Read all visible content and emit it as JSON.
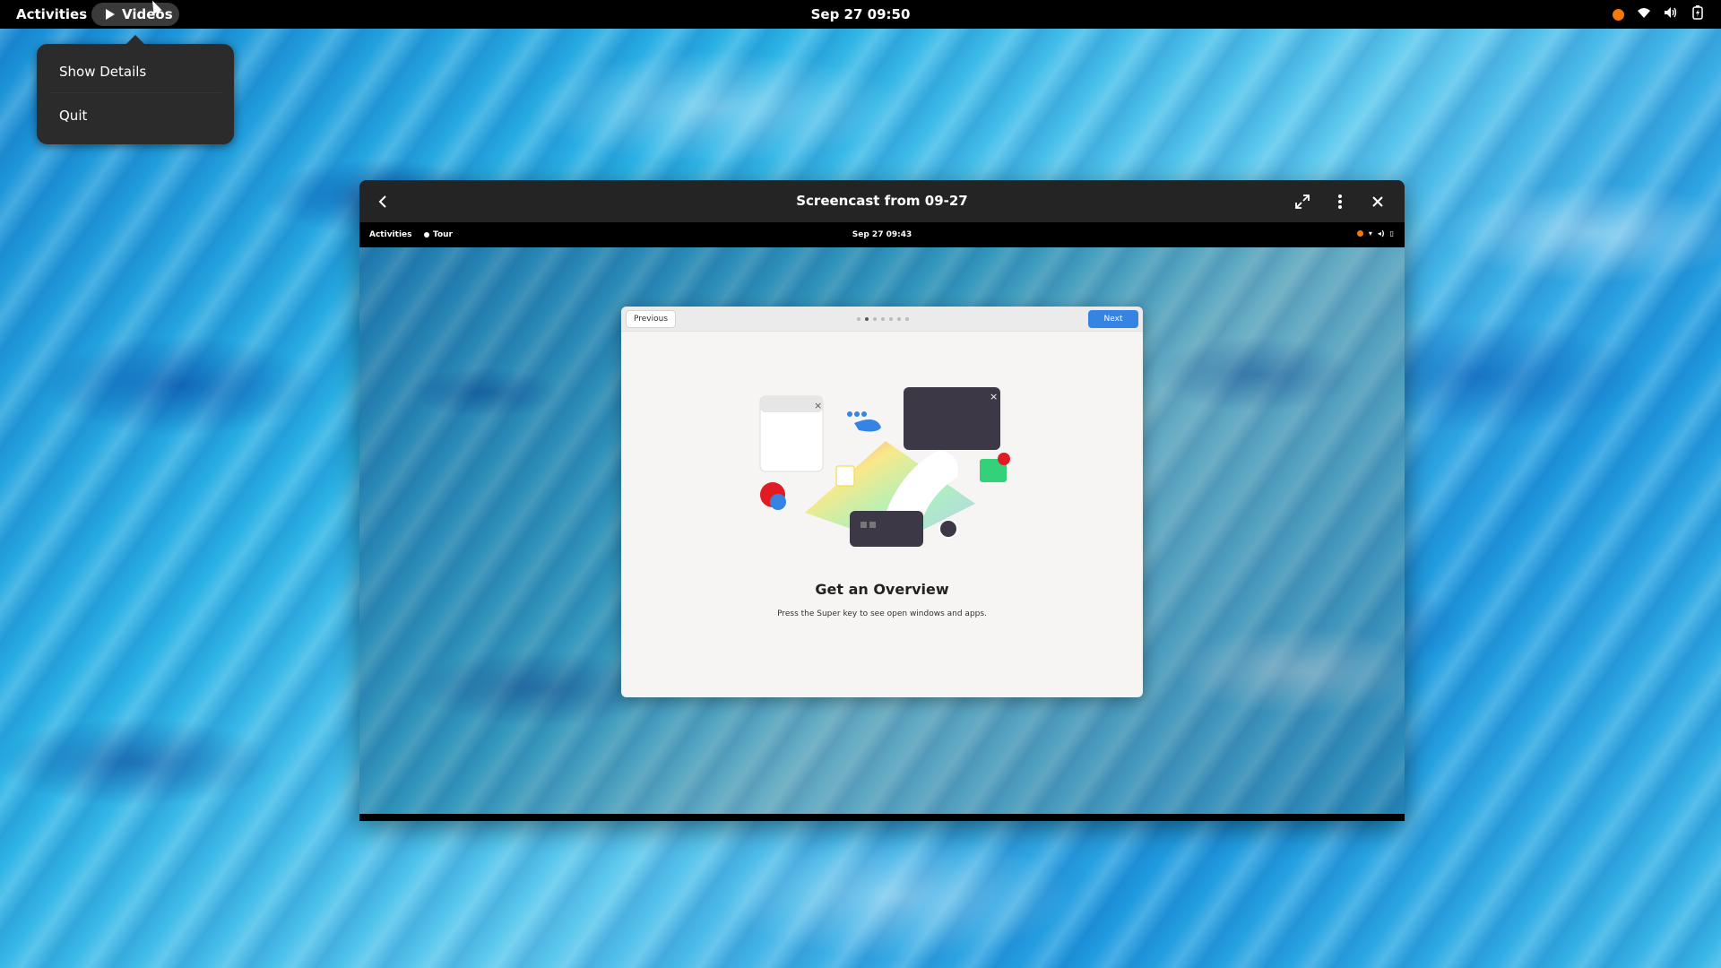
{
  "topbar": {
    "activities": "Activities",
    "app_name": "Videos",
    "clock": "Sep 27  09:50"
  },
  "app_menu": {
    "items": [
      "Show Details",
      "Quit"
    ]
  },
  "window": {
    "title": "Screencast from 09-27"
  },
  "recording": {
    "topbar": {
      "activities": "Activities",
      "app_name": "Tour",
      "clock": "Sep 27  09:43"
    },
    "tour": {
      "previous_label": "Previous",
      "next_label": "Next",
      "page_count": 7,
      "current_page": 2,
      "heading": "Get an Overview",
      "description": "Press the Super key to see open windows and apps."
    }
  },
  "colors": {
    "accent": "#3584e4",
    "status_dot": "#f57900",
    "topbar": "#000000"
  }
}
